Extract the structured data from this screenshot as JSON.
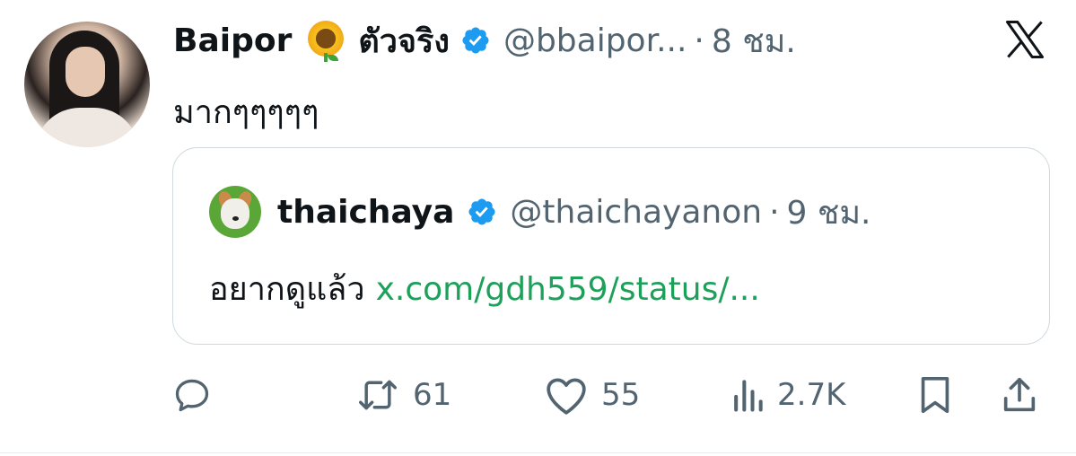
{
  "tweet": {
    "display_name": "Baipor",
    "name_suffix": "ตัวจริง",
    "handle": "@bbaipor...",
    "separator": "·",
    "time": "8 ชม.",
    "text": "มากๆๆๆๆๆ",
    "emoji": "sunflower-icon"
  },
  "quote": {
    "display_name": "thaichaya",
    "handle": "@thaichayanon",
    "separator": "·",
    "time": "9 ชม.",
    "text": "อยากดูแล้ว",
    "link": "x.com/gdh559/status/..."
  },
  "actions": {
    "retweets": "61",
    "likes": "55",
    "views": "2.7K"
  },
  "colors": {
    "verified": "#1d9bf0",
    "secondary_text": "#536471",
    "link": "#1da15a",
    "border": "#cfd9de"
  },
  "icons": [
    "x-logo-icon",
    "verified-badge-icon",
    "reply-icon",
    "retweet-icon",
    "like-icon",
    "views-icon",
    "bookmark-icon",
    "share-icon"
  ]
}
